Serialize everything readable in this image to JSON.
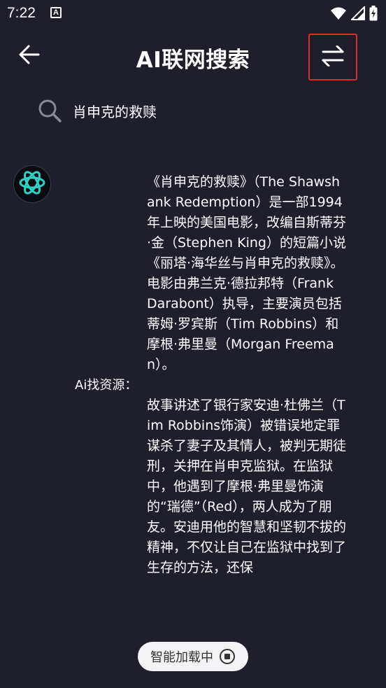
{
  "status_bar": {
    "time": "7:22",
    "app_icon_letter": "A",
    "icons": [
      "wifi-icon",
      "signal-icon",
      "battery-charging-icon"
    ]
  },
  "header": {
    "title": "AI联网搜索",
    "back_icon": "arrow-left-icon",
    "swap_icon": "swap-arrows-icon",
    "highlight_color": "#e02b2b"
  },
  "search": {
    "icon": "search-icon",
    "query": "肖申克的救赎"
  },
  "result": {
    "avatar_icon": "ai-logo-icon",
    "source_label": "Ai找资源：",
    "paragraphs": [
      "《肖申克的救赎》（The Shawshank Redemption）是一部1994年上映的美国电影，改编自斯蒂芬·金（Stephen King）的短篇小说《丽塔·海华丝与肖申克的救赎》。电影由弗兰克·德拉邦特（Frank Darabont）执导，主要演员包括蒂姆·罗宾斯（Tim Robbins）和摩根·弗里曼（Morgan Freeman）。",
      "故事讲述了银行家安迪·杜佛兰（Tim Robbins饰演）被错误地定罪谋杀了妻子及其情人，被判无期徒刑，关押在肖申克监狱。在监狱中，他遇到了摩根·弗里曼饰演的“瑞德”（Red），两人成为了朋友。安迪用他的智慧和坚韧不拔的精神，不仅让自己在监狱中找到了生存的方法，还保"
    ]
  },
  "loading": {
    "label": "智能加载中",
    "stop_icon": "stop-circle-icon"
  },
  "colors": {
    "background": "#1f1f2c",
    "accent_logo": "#2fd3c4",
    "pill_background": "#f3f3f5"
  }
}
